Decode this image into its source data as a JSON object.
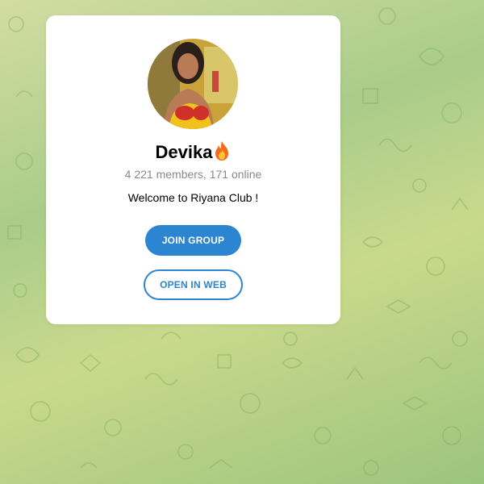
{
  "background": {
    "gradient_colors": [
      "#d3dca2",
      "#a9cc8a",
      "#c9d98c",
      "#9cc47d"
    ],
    "pattern": "doodle-icons"
  },
  "group": {
    "name": "Devika",
    "name_emoji_icon": "fire-icon",
    "members_text": "4 221 members, 171 online",
    "description": "Welcome to Riyana Club !"
  },
  "actions": {
    "join_label": "JOIN GROUP",
    "open_web_label": "OPEN IN WEB"
  },
  "colors": {
    "accent": "#2b85d0",
    "card": "#ffffff",
    "muted_text": "#8a8a8a"
  }
}
